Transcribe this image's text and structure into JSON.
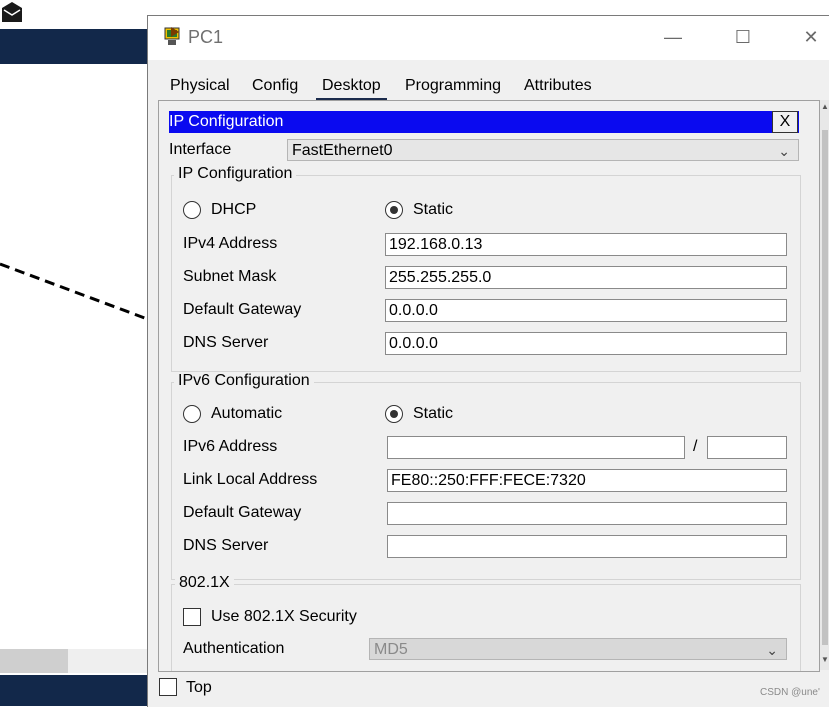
{
  "window": {
    "title": "PC1",
    "minimize_glyph": "—",
    "maximize_glyph": "☐",
    "close_glyph": "✕"
  },
  "tabs": [
    {
      "label": "Physical"
    },
    {
      "label": "Config"
    },
    {
      "label": "Desktop",
      "active": true
    },
    {
      "label": "Programming"
    },
    {
      "label": "Attributes"
    }
  ],
  "panel": {
    "header": "IP Configuration",
    "close_label": "X",
    "interface_label": "Interface",
    "interface_value": "FastEthernet0"
  },
  "ipv4": {
    "group_title": "IP Configuration",
    "dhcp_label": "DHCP",
    "static_label": "Static",
    "mode": "Static",
    "ipv4_address_label": "IPv4 Address",
    "ipv4_address": "192.168.0.13",
    "subnet_mask_label": "Subnet Mask",
    "subnet_mask": "255.255.255.0",
    "default_gateway_label": "Default Gateway",
    "default_gateway": "0.0.0.0",
    "dns_server_label": "DNS Server",
    "dns_server": "0.0.0.0"
  },
  "ipv6": {
    "group_title": "IPv6 Configuration",
    "automatic_label": "Automatic",
    "static_label": "Static",
    "mode": "Static",
    "ipv6_address_label": "IPv6 Address",
    "ipv6_address": "",
    "prefix_separator": "/",
    "prefix_length": "",
    "link_local_label": "Link Local Address",
    "link_local": "FE80::250:FFF:FECE:7320",
    "default_gateway_label": "Default Gateway",
    "default_gateway": "",
    "dns_server_label": "DNS Server",
    "dns_server": ""
  },
  "dot1x": {
    "group_title": "802.1X",
    "use_security_label": "Use 802.1X Security",
    "use_security_checked": false,
    "authentication_label": "Authentication",
    "authentication_value": "MD5"
  },
  "footer": {
    "top_label": "Top",
    "top_checked": false
  },
  "watermark": "CSDN @une'",
  "colors": {
    "header_bg": "#0a0af0",
    "background_app_bar": "#12284a",
    "active_tab_underline": "#1b2b4c"
  }
}
